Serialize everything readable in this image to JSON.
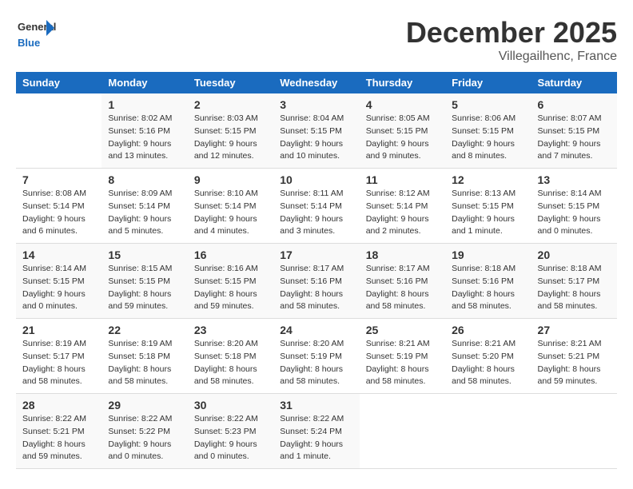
{
  "logo": {
    "general": "General",
    "blue": "Blue"
  },
  "title": "December 2025",
  "subtitle": "Villegailhenc, France",
  "headers": [
    "Sunday",
    "Monday",
    "Tuesday",
    "Wednesday",
    "Thursday",
    "Friday",
    "Saturday"
  ],
  "weeks": [
    [
      {
        "day": "",
        "info": ""
      },
      {
        "day": "1",
        "info": "Sunrise: 8:02 AM\nSunset: 5:16 PM\nDaylight: 9 hours\nand 13 minutes."
      },
      {
        "day": "2",
        "info": "Sunrise: 8:03 AM\nSunset: 5:15 PM\nDaylight: 9 hours\nand 12 minutes."
      },
      {
        "day": "3",
        "info": "Sunrise: 8:04 AM\nSunset: 5:15 PM\nDaylight: 9 hours\nand 10 minutes."
      },
      {
        "day": "4",
        "info": "Sunrise: 8:05 AM\nSunset: 5:15 PM\nDaylight: 9 hours\nand 9 minutes."
      },
      {
        "day": "5",
        "info": "Sunrise: 8:06 AM\nSunset: 5:15 PM\nDaylight: 9 hours\nand 8 minutes."
      },
      {
        "day": "6",
        "info": "Sunrise: 8:07 AM\nSunset: 5:15 PM\nDaylight: 9 hours\nand 7 minutes."
      }
    ],
    [
      {
        "day": "7",
        "info": "Sunrise: 8:08 AM\nSunset: 5:14 PM\nDaylight: 9 hours\nand 6 minutes."
      },
      {
        "day": "8",
        "info": "Sunrise: 8:09 AM\nSunset: 5:14 PM\nDaylight: 9 hours\nand 5 minutes."
      },
      {
        "day": "9",
        "info": "Sunrise: 8:10 AM\nSunset: 5:14 PM\nDaylight: 9 hours\nand 4 minutes."
      },
      {
        "day": "10",
        "info": "Sunrise: 8:11 AM\nSunset: 5:14 PM\nDaylight: 9 hours\nand 3 minutes."
      },
      {
        "day": "11",
        "info": "Sunrise: 8:12 AM\nSunset: 5:14 PM\nDaylight: 9 hours\nand 2 minutes."
      },
      {
        "day": "12",
        "info": "Sunrise: 8:13 AM\nSunset: 5:15 PM\nDaylight: 9 hours\nand 1 minute."
      },
      {
        "day": "13",
        "info": "Sunrise: 8:14 AM\nSunset: 5:15 PM\nDaylight: 9 hours\nand 0 minutes."
      }
    ],
    [
      {
        "day": "14",
        "info": "Sunrise: 8:14 AM\nSunset: 5:15 PM\nDaylight: 9 hours\nand 0 minutes."
      },
      {
        "day": "15",
        "info": "Sunrise: 8:15 AM\nSunset: 5:15 PM\nDaylight: 8 hours\nand 59 minutes."
      },
      {
        "day": "16",
        "info": "Sunrise: 8:16 AM\nSunset: 5:15 PM\nDaylight: 8 hours\nand 59 minutes."
      },
      {
        "day": "17",
        "info": "Sunrise: 8:17 AM\nSunset: 5:16 PM\nDaylight: 8 hours\nand 58 minutes."
      },
      {
        "day": "18",
        "info": "Sunrise: 8:17 AM\nSunset: 5:16 PM\nDaylight: 8 hours\nand 58 minutes."
      },
      {
        "day": "19",
        "info": "Sunrise: 8:18 AM\nSunset: 5:16 PM\nDaylight: 8 hours\nand 58 minutes."
      },
      {
        "day": "20",
        "info": "Sunrise: 8:18 AM\nSunset: 5:17 PM\nDaylight: 8 hours\nand 58 minutes."
      }
    ],
    [
      {
        "day": "21",
        "info": "Sunrise: 8:19 AM\nSunset: 5:17 PM\nDaylight: 8 hours\nand 58 minutes."
      },
      {
        "day": "22",
        "info": "Sunrise: 8:19 AM\nSunset: 5:18 PM\nDaylight: 8 hours\nand 58 minutes."
      },
      {
        "day": "23",
        "info": "Sunrise: 8:20 AM\nSunset: 5:18 PM\nDaylight: 8 hours\nand 58 minutes."
      },
      {
        "day": "24",
        "info": "Sunrise: 8:20 AM\nSunset: 5:19 PM\nDaylight: 8 hours\nand 58 minutes."
      },
      {
        "day": "25",
        "info": "Sunrise: 8:21 AM\nSunset: 5:19 PM\nDaylight: 8 hours\nand 58 minutes."
      },
      {
        "day": "26",
        "info": "Sunrise: 8:21 AM\nSunset: 5:20 PM\nDaylight: 8 hours\nand 58 minutes."
      },
      {
        "day": "27",
        "info": "Sunrise: 8:21 AM\nSunset: 5:21 PM\nDaylight: 8 hours\nand 59 minutes."
      }
    ],
    [
      {
        "day": "28",
        "info": "Sunrise: 8:22 AM\nSunset: 5:21 PM\nDaylight: 8 hours\nand 59 minutes."
      },
      {
        "day": "29",
        "info": "Sunrise: 8:22 AM\nSunset: 5:22 PM\nDaylight: 9 hours\nand 0 minutes."
      },
      {
        "day": "30",
        "info": "Sunrise: 8:22 AM\nSunset: 5:23 PM\nDaylight: 9 hours\nand 0 minutes."
      },
      {
        "day": "31",
        "info": "Sunrise: 8:22 AM\nSunset: 5:24 PM\nDaylight: 9 hours\nand 1 minute."
      },
      {
        "day": "",
        "info": ""
      },
      {
        "day": "",
        "info": ""
      },
      {
        "day": "",
        "info": ""
      }
    ]
  ]
}
